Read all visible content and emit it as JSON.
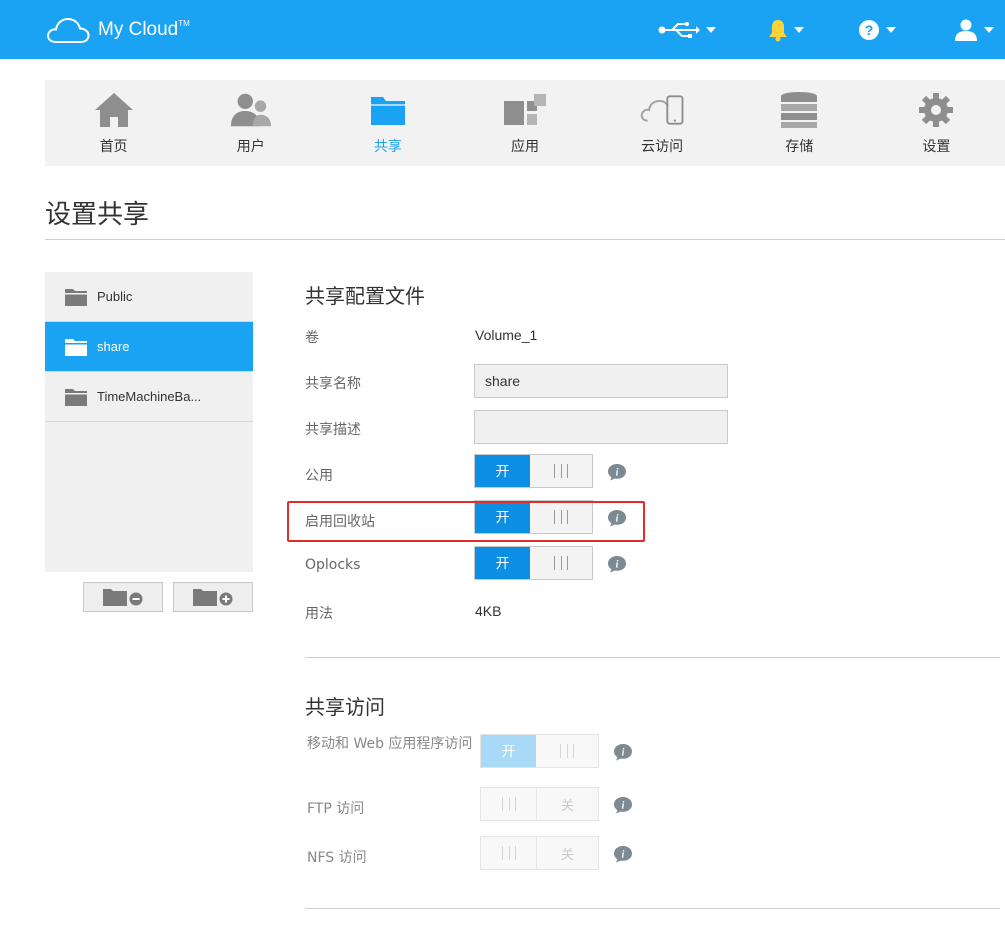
{
  "app": {
    "brand": "My Cloud",
    "trademark": "TM"
  },
  "topbar_icons": [
    "usb-icon",
    "bell-icon",
    "help-icon",
    "user-icon"
  ],
  "nav": {
    "items": [
      {
        "label": "首页",
        "icon": "home-icon"
      },
      {
        "label": "用户",
        "icon": "users-icon"
      },
      {
        "label": "共享",
        "icon": "folder-icon",
        "active": true
      },
      {
        "label": "应用",
        "icon": "apps-icon"
      },
      {
        "label": "云访问",
        "icon": "cloud-access-icon"
      },
      {
        "label": "存储",
        "icon": "storage-icon"
      },
      {
        "label": "设置",
        "icon": "gear-icon"
      }
    ]
  },
  "page": {
    "title": "设置共享"
  },
  "shares": {
    "items": [
      {
        "label": "Public"
      },
      {
        "label": "share",
        "selected": true
      },
      {
        "label": "TimeMachineBa..."
      }
    ]
  },
  "profile": {
    "title": "共享配置文件",
    "volume_label": "卷",
    "volume_value": "Volume_1",
    "name_label": "共享名称",
    "name_value": "share",
    "desc_label": "共享描述",
    "desc_value": "",
    "public_label": "公用",
    "public_toggle": "开",
    "recycle_label": "启用回收站",
    "recycle_toggle": "开",
    "oplocks_label": "Oplocks",
    "oplocks_toggle": "开",
    "usage_label": "用法",
    "usage_value": "4KB"
  },
  "access": {
    "title": "共享访问",
    "mobile_label": "移动和 Web 应用程序访问",
    "mobile_toggle": "开",
    "ftp_label": "FTP 访问",
    "ftp_toggle": "关",
    "nfs_label": "NFS 访问",
    "nfs_toggle": "关"
  },
  "colors": {
    "brand": "#1aa3f2",
    "toggle_on": "#0d8fe6",
    "highlight": "#e22b2b"
  }
}
